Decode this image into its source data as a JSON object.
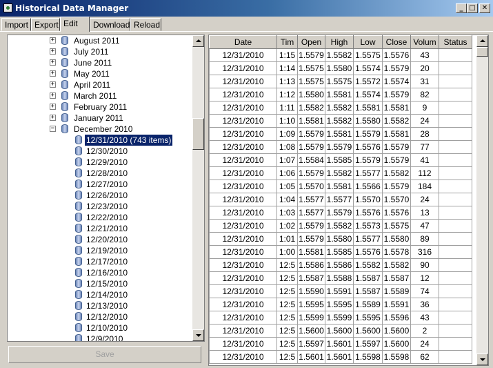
{
  "window": {
    "title": "Historical Data Manager",
    "min": "_",
    "max": "□",
    "close": "✕"
  },
  "tabs": [
    "Import",
    "Export",
    "Edit",
    "Download",
    "Reload"
  ],
  "tree": {
    "months": [
      {
        "label": "August 2011"
      },
      {
        "label": "July 2011"
      },
      {
        "label": "June 2011"
      },
      {
        "label": "May 2011"
      },
      {
        "label": "April 2011"
      },
      {
        "label": "March 2011"
      },
      {
        "label": "February 2011"
      },
      {
        "label": "January 2011"
      }
    ],
    "expanded_month": "December 2010",
    "days": [
      "12/31/2010 (743 items)",
      "12/30/2010",
      "12/29/2010",
      "12/28/2010",
      "12/27/2010",
      "12/26/2010",
      "12/23/2010",
      "12/22/2010",
      "12/21/2010",
      "12/20/2010",
      "12/19/2010",
      "12/17/2010",
      "12/16/2010",
      "12/15/2010",
      "12/14/2010",
      "12/13/2010",
      "12/12/2010",
      "12/10/2010",
      "12/9/2010"
    ],
    "selected_day_index": 0
  },
  "save_label": "Save",
  "grid": {
    "columns": [
      "Date",
      "Tim",
      "Open",
      "High",
      "Low",
      "Close",
      "Volum",
      "Status"
    ],
    "rows": [
      [
        "12/31/2010",
        "1:15",
        "1.5579",
        "1.5582",
        "1.5575",
        "1.5576",
        "43",
        ""
      ],
      [
        "12/31/2010",
        "1:14",
        "1.5575",
        "1.5580",
        "1.5574",
        "1.5579",
        "20",
        ""
      ],
      [
        "12/31/2010",
        "1:13",
        "1.5575",
        "1.5575",
        "1.5572",
        "1.5574",
        "31",
        ""
      ],
      [
        "12/31/2010",
        "1:12",
        "1.5580",
        "1.5581",
        "1.5574",
        "1.5579",
        "82",
        ""
      ],
      [
        "12/31/2010",
        "1:11",
        "1.5582",
        "1.5582",
        "1.5581",
        "1.5581",
        "9",
        ""
      ],
      [
        "12/31/2010",
        "1:10",
        "1.5581",
        "1.5582",
        "1.5580",
        "1.5582",
        "24",
        ""
      ],
      [
        "12/31/2010",
        "1:09",
        "1.5579",
        "1.5581",
        "1.5579",
        "1.5581",
        "28",
        ""
      ],
      [
        "12/31/2010",
        "1:08",
        "1.5579",
        "1.5579",
        "1.5576",
        "1.5579",
        "77",
        ""
      ],
      [
        "12/31/2010",
        "1:07",
        "1.5584",
        "1.5585",
        "1.5579",
        "1.5579",
        "41",
        ""
      ],
      [
        "12/31/2010",
        "1:06",
        "1.5579",
        "1.5582",
        "1.5577",
        "1.5582",
        "112",
        ""
      ],
      [
        "12/31/2010",
        "1:05",
        "1.5570",
        "1.5581",
        "1.5566",
        "1.5579",
        "184",
        ""
      ],
      [
        "12/31/2010",
        "1:04",
        "1.5577",
        "1.5577",
        "1.5570",
        "1.5570",
        "24",
        ""
      ],
      [
        "12/31/2010",
        "1:03",
        "1.5577",
        "1.5579",
        "1.5576",
        "1.5576",
        "13",
        ""
      ],
      [
        "12/31/2010",
        "1:02",
        "1.5579",
        "1.5582",
        "1.5573",
        "1.5575",
        "47",
        ""
      ],
      [
        "12/31/2010",
        "1:01",
        "1.5579",
        "1.5580",
        "1.5577",
        "1.5580",
        "89",
        ""
      ],
      [
        "12/31/2010",
        "1:00",
        "1.5581",
        "1.5585",
        "1.5576",
        "1.5578",
        "316",
        ""
      ],
      [
        "12/31/2010",
        "12:5",
        "1.5586",
        "1.5586",
        "1.5582",
        "1.5582",
        "90",
        ""
      ],
      [
        "12/31/2010",
        "12:5",
        "1.5587",
        "1.5588",
        "1.5587",
        "1.5587",
        "12",
        ""
      ],
      [
        "12/31/2010",
        "12:5",
        "1.5590",
        "1.5591",
        "1.5587",
        "1.5589",
        "74",
        ""
      ],
      [
        "12/31/2010",
        "12:5",
        "1.5595",
        "1.5595",
        "1.5589",
        "1.5591",
        "36",
        ""
      ],
      [
        "12/31/2010",
        "12:5",
        "1.5599",
        "1.5599",
        "1.5595",
        "1.5596",
        "43",
        ""
      ],
      [
        "12/31/2010",
        "12:5",
        "1.5600",
        "1.5600",
        "1.5600",
        "1.5600",
        "2",
        ""
      ],
      [
        "12/31/2010",
        "12:5",
        "1.5597",
        "1.5601",
        "1.5597",
        "1.5600",
        "24",
        ""
      ],
      [
        "12/31/2010",
        "12:5",
        "1.5601",
        "1.5601",
        "1.5598",
        "1.5598",
        "62",
        ""
      ]
    ]
  }
}
